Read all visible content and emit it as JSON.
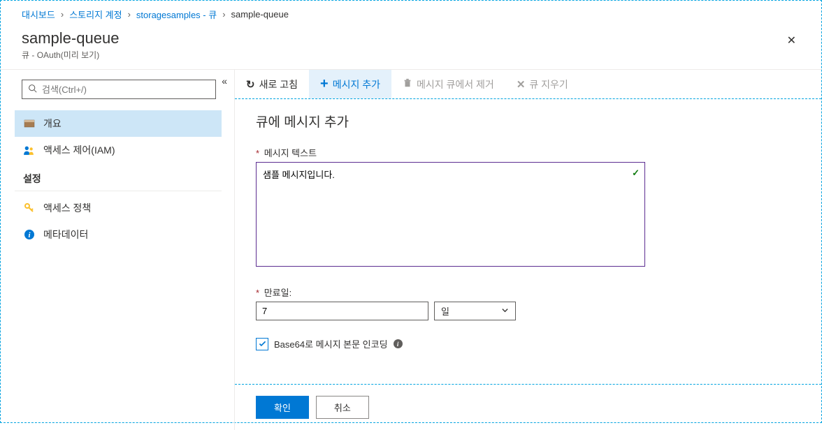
{
  "breadcrumb": {
    "items": [
      {
        "label": "대시보드",
        "link": true
      },
      {
        "label": "스토리지 계정",
        "link": true
      },
      {
        "label": "storagesamples - 큐",
        "link": true
      },
      {
        "label": "sample-queue",
        "link": false
      }
    ]
  },
  "header": {
    "title": "sample-queue",
    "subtitle": "큐 - OAuth(미리 보기)"
  },
  "sidebar": {
    "search_placeholder": "검색(Ctrl+/)",
    "items": {
      "overview": "개요",
      "iam": "액세스 제어(IAM)"
    },
    "section_settings": "설정",
    "settings_items": {
      "access_policy": "액세스 정책",
      "metadata": "메타데이터"
    }
  },
  "toolbar": {
    "refresh": "새로 고침",
    "add_message": "메시지 추가",
    "remove_from_queue": "메시지 큐에서 제거",
    "clear_queue": "큐 지우기"
  },
  "form": {
    "title": "큐에 메시지 추가",
    "message_text_label": "메시지 텍스트",
    "message_text_value": "샘플 메시지입니다.",
    "expiry_label": "만료일:",
    "expiry_value": "7",
    "expiry_unit": "일",
    "base64_label": "Base64로 메시지 본문 인코딩"
  },
  "footer": {
    "ok": "확인",
    "cancel": "취소"
  }
}
